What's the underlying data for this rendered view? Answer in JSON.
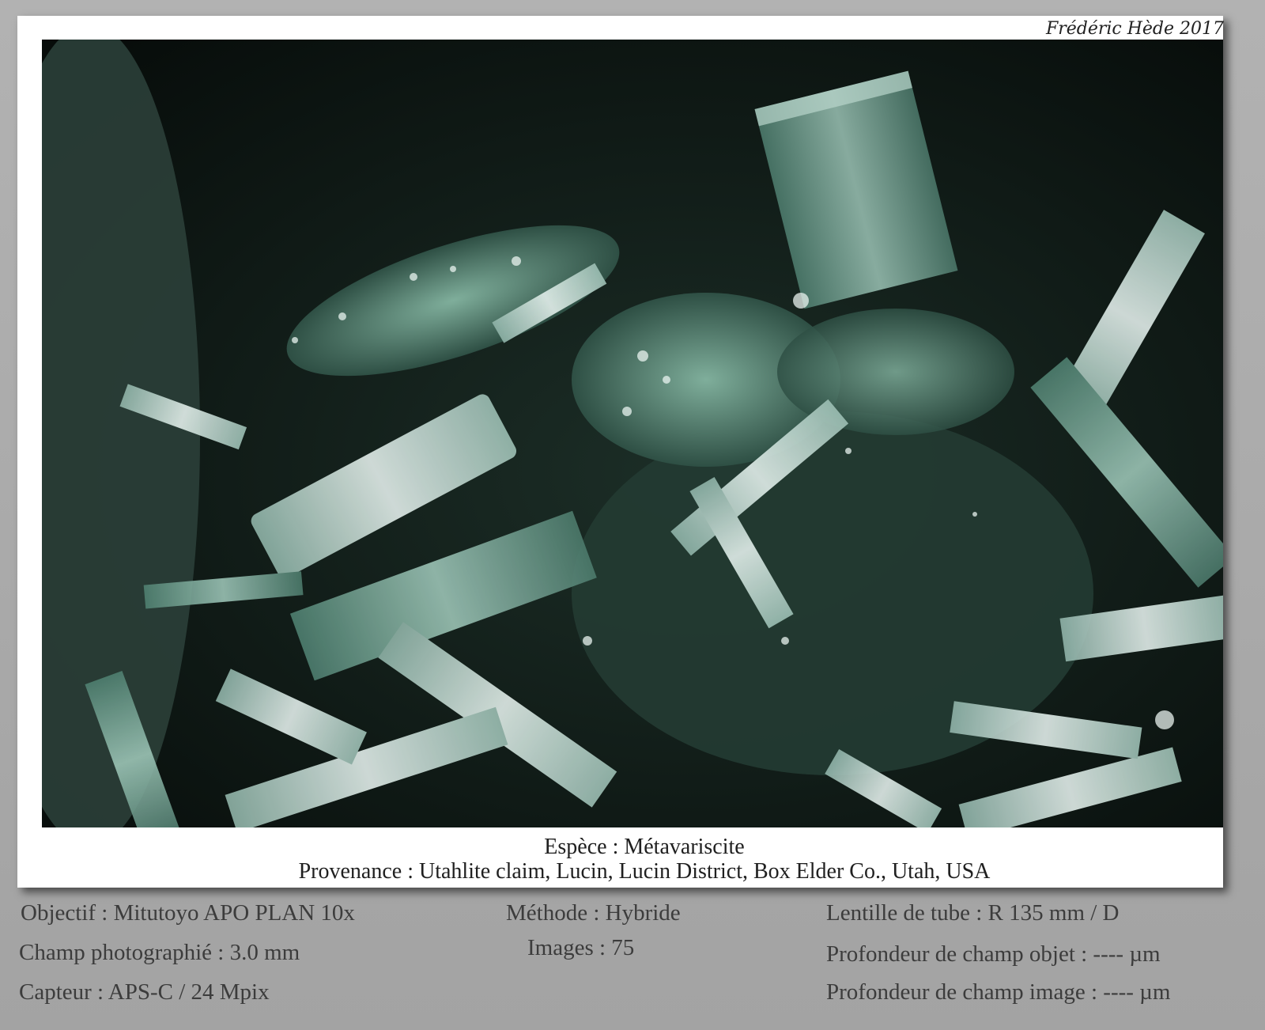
{
  "signature": "Frédéric Hède 2017",
  "photo": {
    "subject": "crystal-cluster-photo",
    "colors": {
      "background": "#0d1512",
      "crystal": "#cfe3dc",
      "matrix": "#5d8f7c"
    }
  },
  "caption": {
    "species": "Espèce : Métavariscite",
    "provenance": "Provenance : Utahlite claim, Lucin, Lucin District, Box Elder Co., Utah, USA"
  },
  "info": {
    "objective": "Objectif : Mitutoyo APO PLAN 10x",
    "field": "Champ photographié : 3.0 mm",
    "sensor": "Capteur : APS-C / 24 Mpix",
    "method": "Méthode : Hybride",
    "images": "Images : 75",
    "tube_lens": "Lentille de tube : R 135 mm / D",
    "dof_object": "Profondeur de champ objet : ---- µm",
    "dof_image": "Profondeur de champ image : ---- µm"
  }
}
